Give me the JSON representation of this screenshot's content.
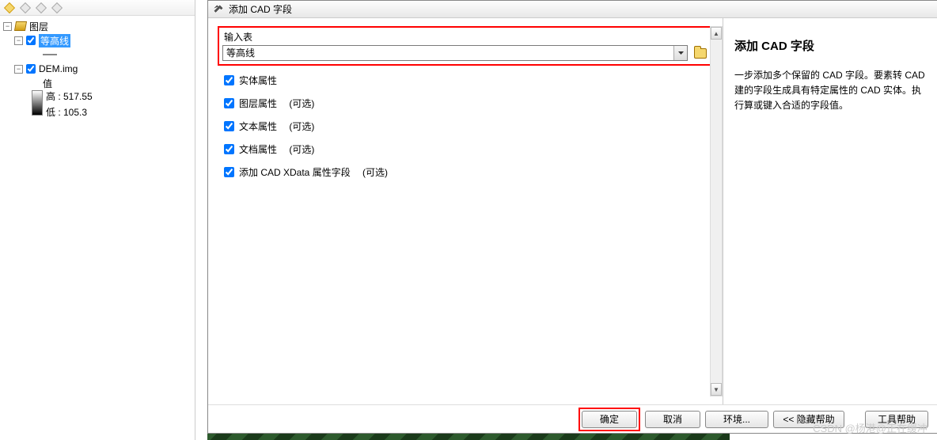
{
  "sidebar": {
    "root_label": "图层",
    "layer1": {
      "label": "等高线",
      "checked": true,
      "expanded": true
    },
    "layer2": {
      "label": "DEM.img",
      "checked": true,
      "expanded": true,
      "value_label": "值",
      "high_label": "高 : 517.55",
      "low_label": "低 : 105.3"
    }
  },
  "dialog": {
    "title": "添加 CAD 字段",
    "input_table_label": "输入表",
    "input_table_value": "等高线",
    "checks": [
      {
        "label": "实体属性",
        "optional": "",
        "checked": true
      },
      {
        "label": "图层属性",
        "optional": "(可选)",
        "checked": true
      },
      {
        "label": "文本属性",
        "optional": "(可选)",
        "checked": true
      },
      {
        "label": "文档属性",
        "optional": "(可选)",
        "checked": true
      },
      {
        "label": "添加 CAD XData 属性字段",
        "optional": "(可选)",
        "checked": true
      }
    ],
    "buttons": {
      "ok": "确定",
      "cancel": "取消",
      "environments": "环境...",
      "hide_help": "<< 隐藏帮助",
      "tool_help": "工具帮助"
    }
  },
  "help": {
    "title": "添加  CAD 字段",
    "body": "一步添加多个保留的 CAD 字段。要素转 CAD 建的字段生成具有特定属性的 CAD 实体。执行算或键入合适的字段值。"
  },
  "watermark": "CSDN @杨港@正在缓冲"
}
